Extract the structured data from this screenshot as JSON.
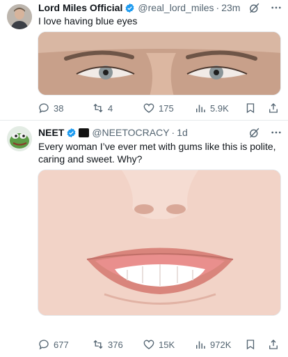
{
  "tweets": [
    {
      "author": {
        "name": "Lord Miles Official",
        "handle": "@real_lord_miles",
        "time": "23m"
      },
      "text": "I love having blue eyes",
      "stats": {
        "replies": "38",
        "reposts": "4",
        "likes": "175",
        "views": "5.9K"
      }
    },
    {
      "author": {
        "name": "NEET",
        "badge": "",
        "handle": "@NEETOCRACY",
        "time": "1d"
      },
      "text": "Every woman I’ve ever met with gums like this is polite, caring and sweet. Why?",
      "stats": {
        "replies": "677",
        "reposts": "376",
        "likes": "15K",
        "views": "972K"
      }
    }
  ],
  "separator": "·",
  "colors": {
    "verified": "#1d9bf0",
    "muted": "#536471",
    "text": "#0f1419"
  },
  "icons": [
    "verified-badge-icon",
    "grok-icon",
    "more-icon",
    "reply-icon",
    "repost-icon",
    "like-icon",
    "views-icon",
    "bookmark-icon",
    "share-icon"
  ]
}
